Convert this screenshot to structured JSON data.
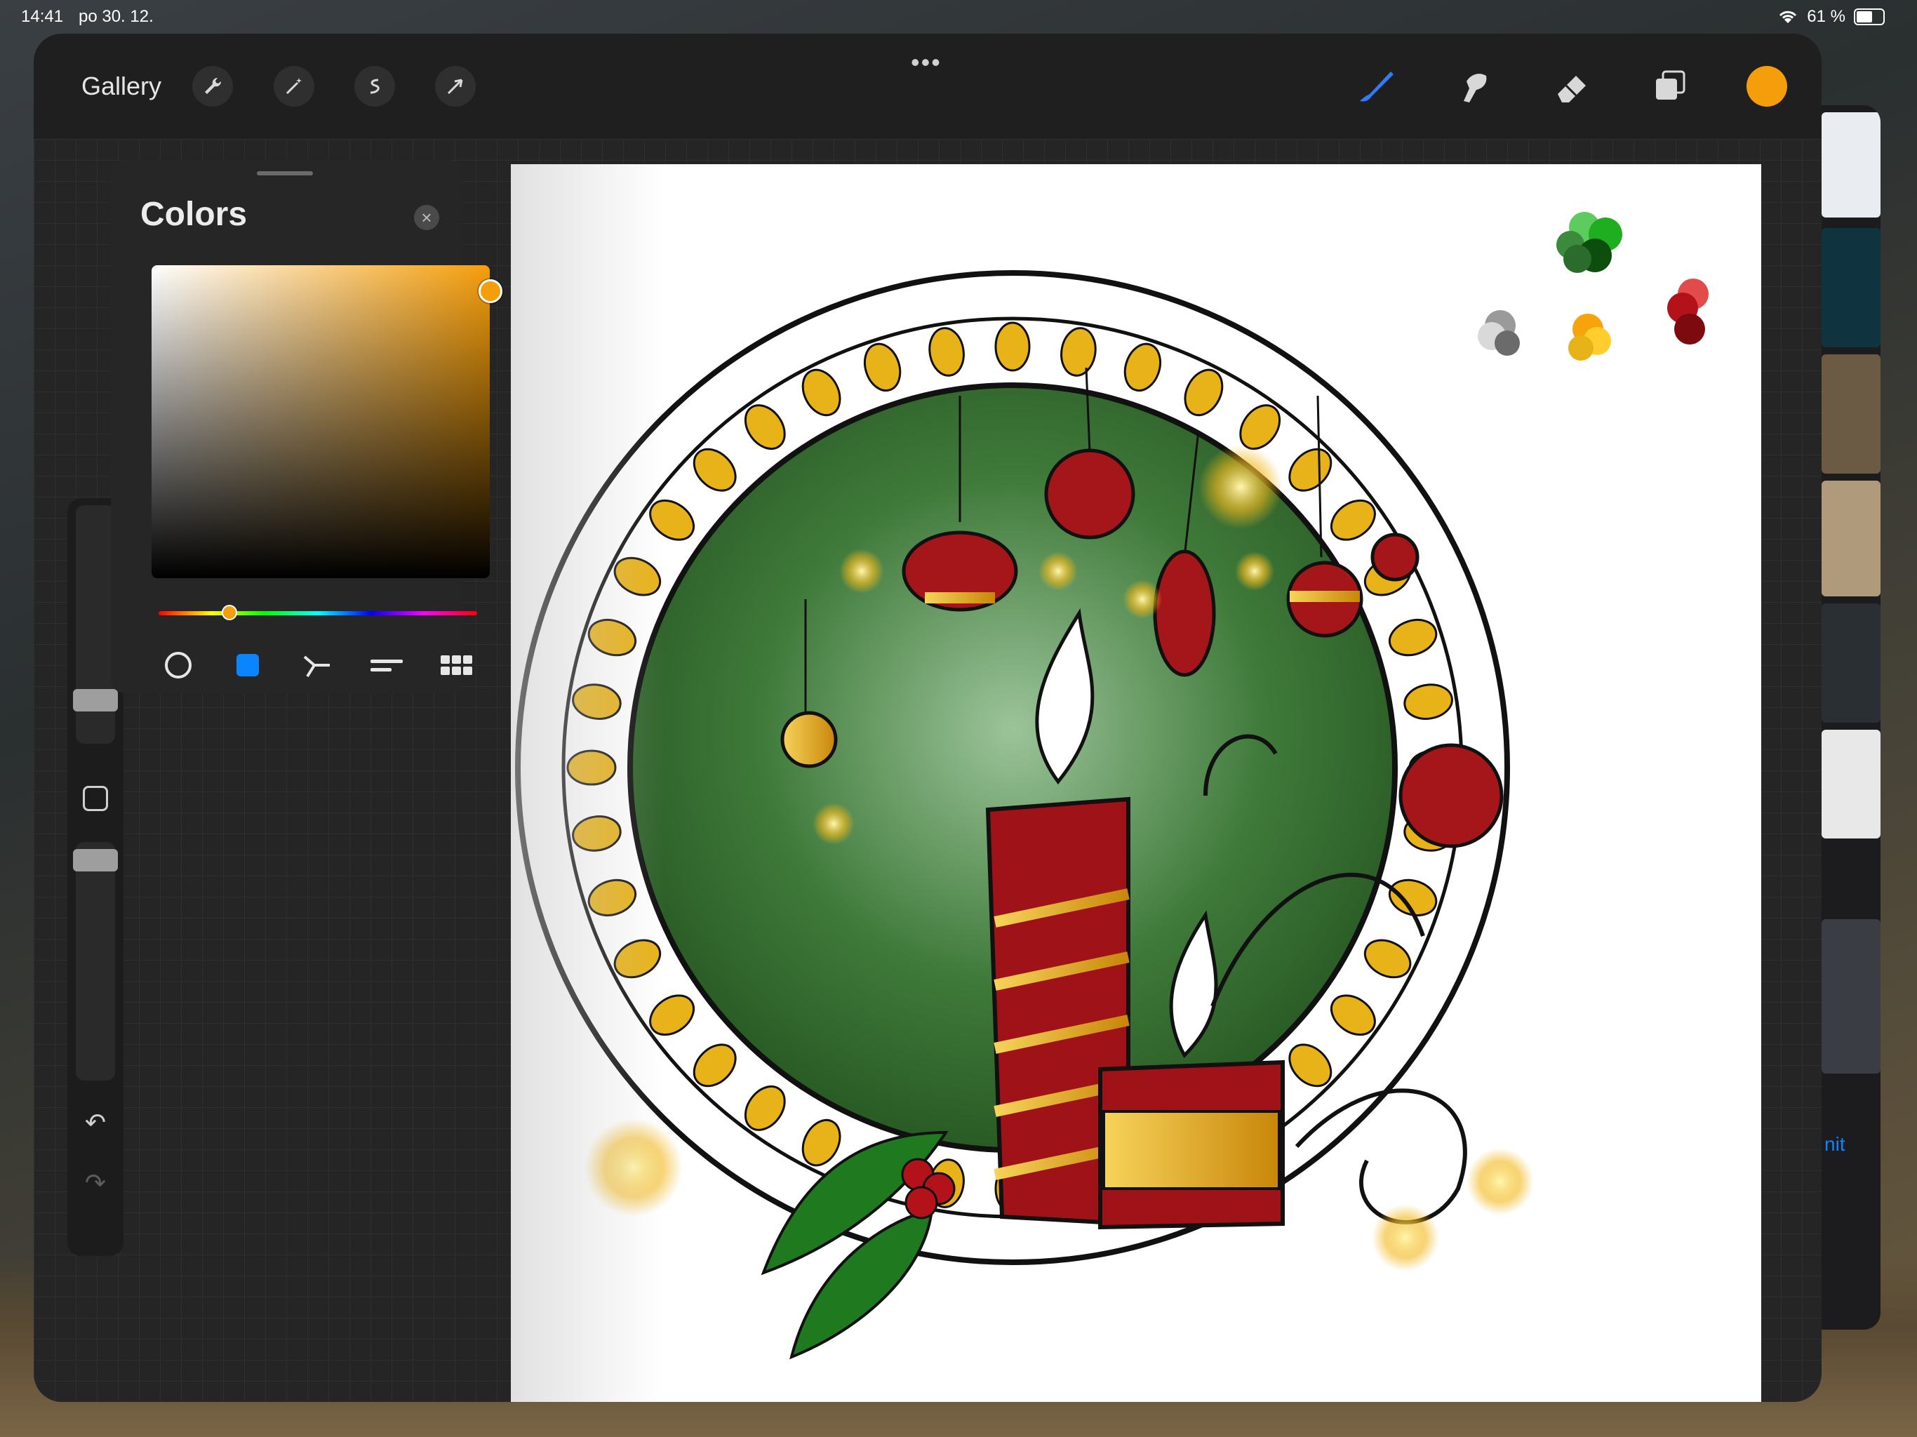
{
  "status_bar": {
    "time": "14:41",
    "date": "po 30. 12.",
    "battery": "61 %"
  },
  "topbar": {
    "multitasking_dots": "•••",
    "gallery_label": "Gallery",
    "left_tools": [
      "wrench-icon",
      "magic-wand-icon",
      "selection-icon",
      "transform-icon"
    ],
    "right_tools": [
      "brush-icon",
      "smudge-icon",
      "eraser-icon",
      "layers-icon"
    ],
    "active_color": "#f59e0b"
  },
  "colors_panel": {
    "title": "Colors",
    "close_icon": "×",
    "selected_hue_color": "#f59e0b",
    "modes": [
      "disc",
      "classic",
      "harmony",
      "value",
      "palettes"
    ]
  },
  "sidebar": {
    "undo_icon": "↶",
    "redo_icon": "↷"
  },
  "side_app": {
    "link_text": "nit"
  },
  "colors": {
    "accent_blue": "#0a84ff",
    "gold": "#e8b219",
    "red": "#a4161a",
    "green": "#2e6b2a"
  }
}
